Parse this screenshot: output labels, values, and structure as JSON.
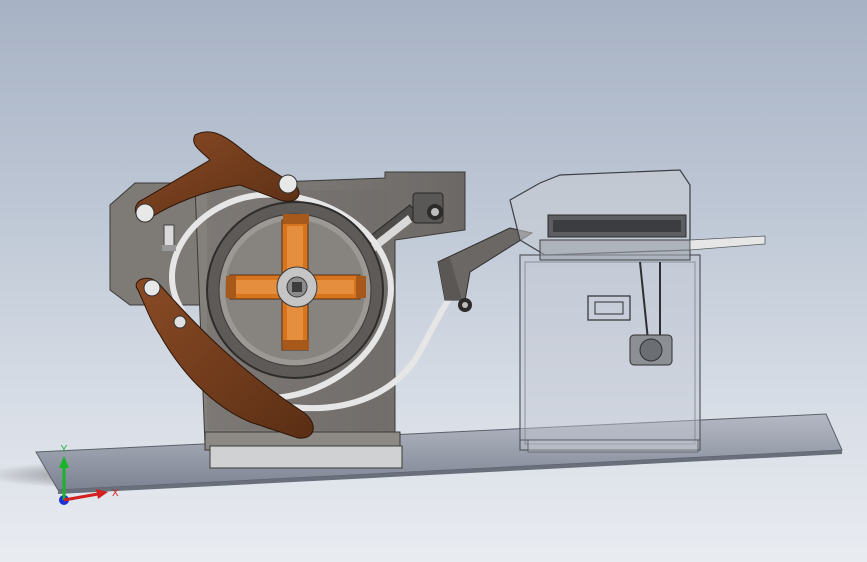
{
  "viewport": {
    "background_top": "#a7b2c4",
    "background_bottom": "#e9ecf1"
  },
  "colors": {
    "frame_gray": "#7d7a78",
    "frame_dark": "#4a4846",
    "arm_brown": "#6b3a1e",
    "orange_parts": "#d7741e",
    "base_plate": "#9aa0ae",
    "transparent_housing": "#c3c8d2"
  },
  "triad": {
    "y_label": "Y",
    "x_label": "X",
    "z_color": "#1c2fd8",
    "y_color": "#19b32a",
    "x_color": "#d21f1f"
  }
}
